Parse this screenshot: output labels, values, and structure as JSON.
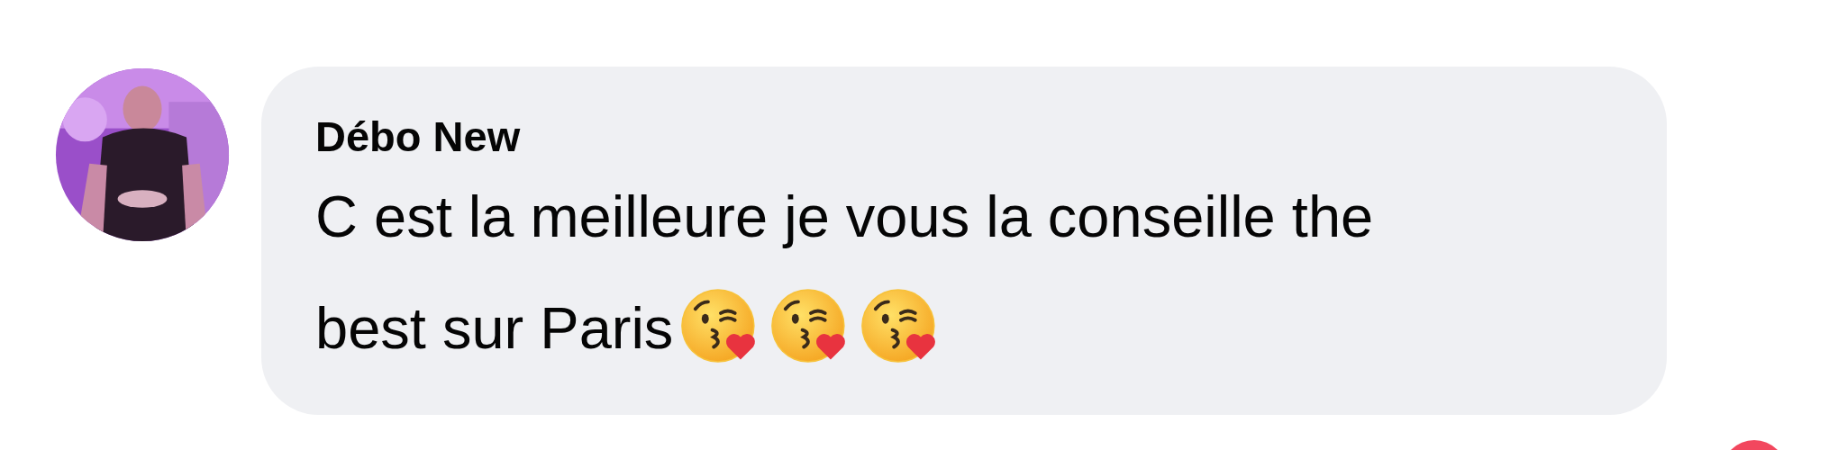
{
  "comment": {
    "author": "Débo New",
    "lines": [
      "C est la meilleure je vous la conseille the",
      "best sur Paris"
    ],
    "emojis": [
      {
        "kind": "kiss"
      },
      {
        "kind": "kiss"
      },
      {
        "kind": "kiss"
      }
    ]
  }
}
